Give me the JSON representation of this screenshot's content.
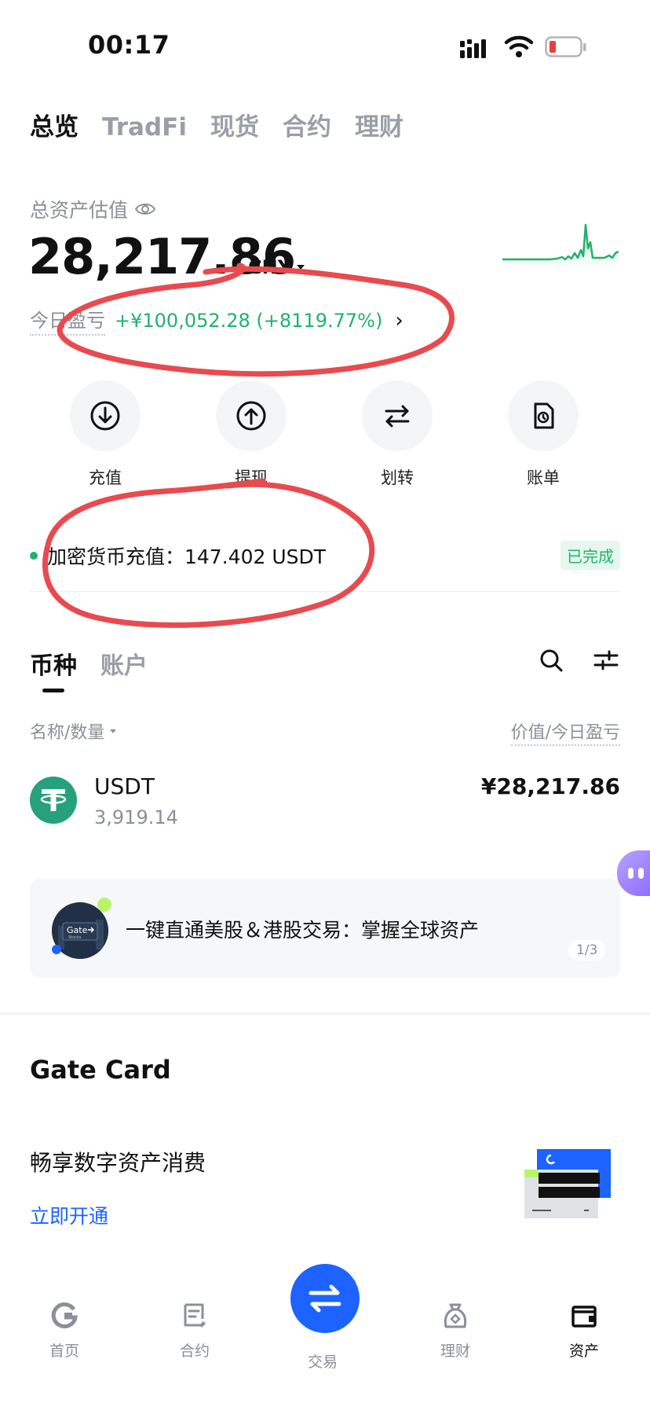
{
  "status_bar": {
    "time": "00:17"
  },
  "top_tabs": [
    {
      "label": "总览",
      "active": true
    },
    {
      "label": "TradFi",
      "active": false
    },
    {
      "label": "现货",
      "active": false
    },
    {
      "label": "合约",
      "active": false
    },
    {
      "label": "理财",
      "active": false
    }
  ],
  "assets": {
    "label": "总资产估值",
    "value": "28,217.86",
    "currency": "CNY",
    "pnl_label": "今日盈亏",
    "pnl_value": "+¥100,052.28 (+8119.77%)"
  },
  "actions": [
    {
      "label": "充值",
      "icon": "deposit-icon"
    },
    {
      "label": "提现",
      "icon": "withdraw-icon"
    },
    {
      "label": "划转",
      "icon": "transfer-icon"
    },
    {
      "label": "账单",
      "icon": "bill-icon"
    }
  ],
  "deposit_record": {
    "text": "加密货币充值：147.402 USDT",
    "status": "已完成"
  },
  "coin_tabs": [
    {
      "label": "币种",
      "active": true
    },
    {
      "label": "账户",
      "active": false
    }
  ],
  "columns": {
    "left": "名称/数量",
    "right": "价值/今日盈亏"
  },
  "coins": [
    {
      "name": "USDT",
      "quantity": "3,919.14",
      "value": "¥28,217.86",
      "color": "#26a17b"
    }
  ],
  "banner": {
    "logo_text": "Gate",
    "logo_sub": "Stocks",
    "text": "一键直通美股＆港股交易：掌握全球资产",
    "page": "1/3"
  },
  "gate_card": {
    "title": "Gate Card",
    "subtitle": "畅享数字资产消费",
    "link": "立即开通"
  },
  "bottom_nav": [
    {
      "label": "首页",
      "icon": "home-icon",
      "active": false
    },
    {
      "label": "合约",
      "icon": "contract-icon",
      "active": false
    },
    {
      "label": "交易",
      "icon": "trade-icon",
      "active": false
    },
    {
      "label": "理财",
      "icon": "finance-icon",
      "active": false
    },
    {
      "label": "资产",
      "icon": "assets-icon",
      "active": true
    }
  ],
  "colors": {
    "accent": "#1d63ff",
    "positive": "#20b26c",
    "annotation": "#e84a4f"
  }
}
